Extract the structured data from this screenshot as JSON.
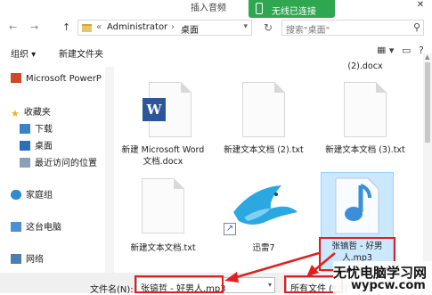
{
  "window": {
    "title": "插入音频"
  },
  "notification": {
    "text": "无线已连接"
  },
  "nav": {
    "back": "←",
    "forward": "→",
    "up": "↑",
    "address": {
      "chevron": "«",
      "crumbs": [
        "Administrator",
        "桌面"
      ],
      "separator": "›"
    },
    "search_placeholder": "搜索\"桌面\""
  },
  "toolbar": {
    "organize_label": "组织 ▾",
    "new_folder_label": "新建文件夹"
  },
  "sidebar": {
    "items": [
      {
        "label": "Microsoft PowerP",
        "icon": "powerpoint-icon"
      },
      {
        "label": "收藏夹",
        "icon": "star-icon"
      },
      {
        "label": "下载",
        "icon": "download-folder-icon"
      },
      {
        "label": "桌面",
        "icon": "desktop-folder-icon"
      },
      {
        "label": "最近访问的位置",
        "icon": "recent-places-icon"
      },
      {
        "label": "家庭组",
        "icon": "homegroup-icon"
      },
      {
        "label": "这台电脑",
        "icon": "computer-icon"
      },
      {
        "label": "网络",
        "icon": "network-icon"
      }
    ]
  },
  "files": [
    {
      "name": "(2).docx",
      "type": "partial"
    },
    {
      "name": "新建 Microsoft Word 文档.docx",
      "type": "word"
    },
    {
      "name": "新建文本文档 (2).txt",
      "type": "text"
    },
    {
      "name": "新建文本文档 (3).txt",
      "type": "text"
    },
    {
      "name": "新建文本文档.txt",
      "type": "text"
    },
    {
      "name": "迅雷7",
      "type": "shortcut"
    },
    {
      "name": "张镐哲 - 好男人.mp3",
      "type": "audio"
    }
  ],
  "bottom": {
    "filename_label": "文件名(N):",
    "filename_value": "张镐哲 - 好男人.mp3",
    "filter_value": "所有文件 (*.*)"
  },
  "watermark": {
    "line1": "无忧电脑学习网",
    "line2": "wypcw.com"
  },
  "colors": {
    "selection": "#cce8ff",
    "annotation": "#e02020",
    "toast": "#2fa750",
    "word": "#2b579a"
  }
}
